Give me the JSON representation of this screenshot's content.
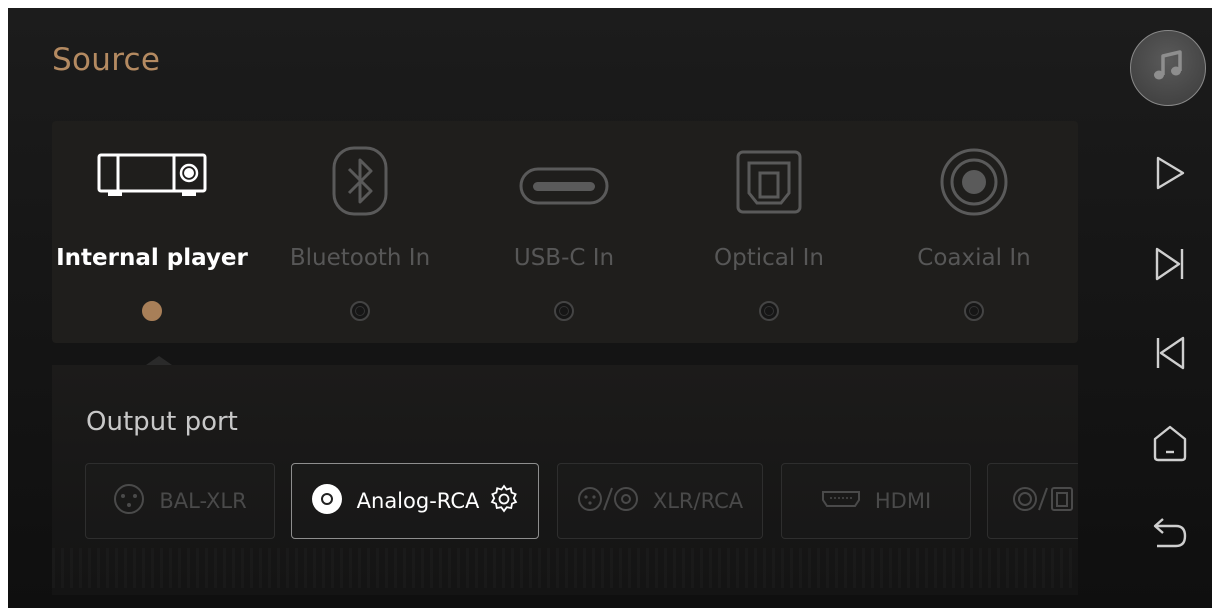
{
  "page": {
    "title": "Source"
  },
  "sources": [
    {
      "label": "Internal player",
      "icon": "player-device-icon",
      "selected": true
    },
    {
      "label": "Bluetooth In",
      "icon": "bluetooth-icon",
      "selected": false
    },
    {
      "label": "USB-C In",
      "icon": "usb-c-icon",
      "selected": false
    },
    {
      "label": "Optical In",
      "icon": "optical-port-icon",
      "selected": false
    },
    {
      "label": "Coaxial In",
      "icon": "coaxial-port-icon",
      "selected": false
    }
  ],
  "output": {
    "title": "Output port",
    "ports": [
      {
        "label": "BAL-XLR",
        "icon": "xlr-icon",
        "selected": false
      },
      {
        "label": "Analog-RCA",
        "icon": "rca-icon",
        "selected": true,
        "has_settings": true
      },
      {
        "label": "XLR/RCA",
        "icon": "xlr-rca-icon",
        "selected": false
      },
      {
        "label": "HDMI",
        "icon": "hdmi-icon",
        "selected": false
      },
      {
        "label": "",
        "icon": "coaxial-optical-icon",
        "selected": false
      }
    ]
  },
  "sidebar": {
    "items": [
      "music-note-icon",
      "play-icon",
      "next-track-icon",
      "previous-track-icon",
      "home-icon",
      "back-icon"
    ]
  },
  "colors": {
    "accent": "#b48a61",
    "radio_selected": "#a87f58",
    "active_label": "#ffffff",
    "inactive_label": "#575757",
    "background": "#171717"
  }
}
